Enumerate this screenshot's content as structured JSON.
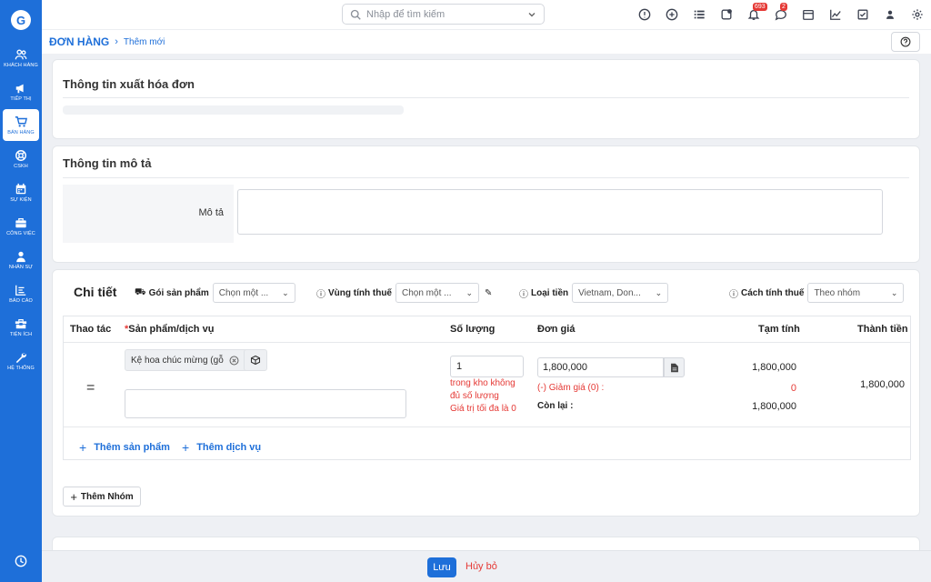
{
  "sidebar": {
    "logo": "G",
    "items": [
      {
        "label": "KHÁCH HÀNG",
        "icon": "users-icon"
      },
      {
        "label": "TIẾP THỊ",
        "icon": "megaphone-icon"
      },
      {
        "label": "BÁN HÀNG",
        "icon": "cart-icon",
        "active": true
      },
      {
        "label": "CSKH",
        "icon": "lifebuoy-icon"
      },
      {
        "label": "SỰ KIỆN",
        "icon": "calendar-icon"
      },
      {
        "label": "CÔNG VIỆC",
        "icon": "briefcase-icon"
      },
      {
        "label": "NHÂN SỰ",
        "icon": "person-icon"
      },
      {
        "label": "BÁO CÁO",
        "icon": "report-icon"
      },
      {
        "label": "TIỆN ÍCH",
        "icon": "toolbox-icon"
      },
      {
        "label": "HỆ THỐNG",
        "icon": "wrench-icon"
      }
    ]
  },
  "header": {
    "search_placeholder": "Nhập để tìm kiếm",
    "notification_count": "693",
    "message_count": "2"
  },
  "breadcrumb": {
    "main": "ĐƠN HÀNG",
    "sub": "Thêm mới"
  },
  "invoice_section": {
    "title": "Thông tin xuất hóa đơn"
  },
  "description_section": {
    "title": "Thông tin mô tả",
    "field_label": "Mô tả",
    "field_value": ""
  },
  "detail_section": {
    "title": "Chi tiết",
    "filters": {
      "package_label": "Gói sản phẩm",
      "package_value": "Chọn một ...",
      "tax_zone_label": "Vùng tính thuế",
      "tax_zone_value": "Chọn một ...",
      "currency_label": "Loại tiền",
      "currency_value": "Vietnam, Don...",
      "tax_method_label": "Cách tính thuế",
      "tax_method_value": "Theo nhóm"
    },
    "columns": {
      "action": "Thao tác",
      "product": "Sản phẩm/dịch vụ",
      "qty": "Số lượng",
      "unit_price": "Đơn giá",
      "subtotal": "Tạm tính",
      "total": "Thành tiền"
    },
    "row": {
      "drag_handle": "=",
      "product_name": "Kệ hoa chúc mừng (gỗ",
      "quantity": "1",
      "stock_warning_1": "trong kho không",
      "stock_warning_2": "đủ số lượng",
      "stock_warning_3": "Giá trị tối đa là 0",
      "unit_price": "1,800,000",
      "discount_label": "(-) Giảm giá (0) :",
      "remaining_label": "Còn lại :",
      "subtotal": "1,800,000",
      "discount_value": "0",
      "remaining_value": "1,800,000",
      "total": "1,800,000"
    },
    "add_product": "Thêm sản phẩm",
    "add_service": "Thêm dịch vụ",
    "add_group": "Thêm Nhóm"
  },
  "footer": {
    "save": "Lưu",
    "cancel": "Hủy bỏ"
  },
  "colors": {
    "primary": "#1e6fd9",
    "danger": "#e53935"
  }
}
